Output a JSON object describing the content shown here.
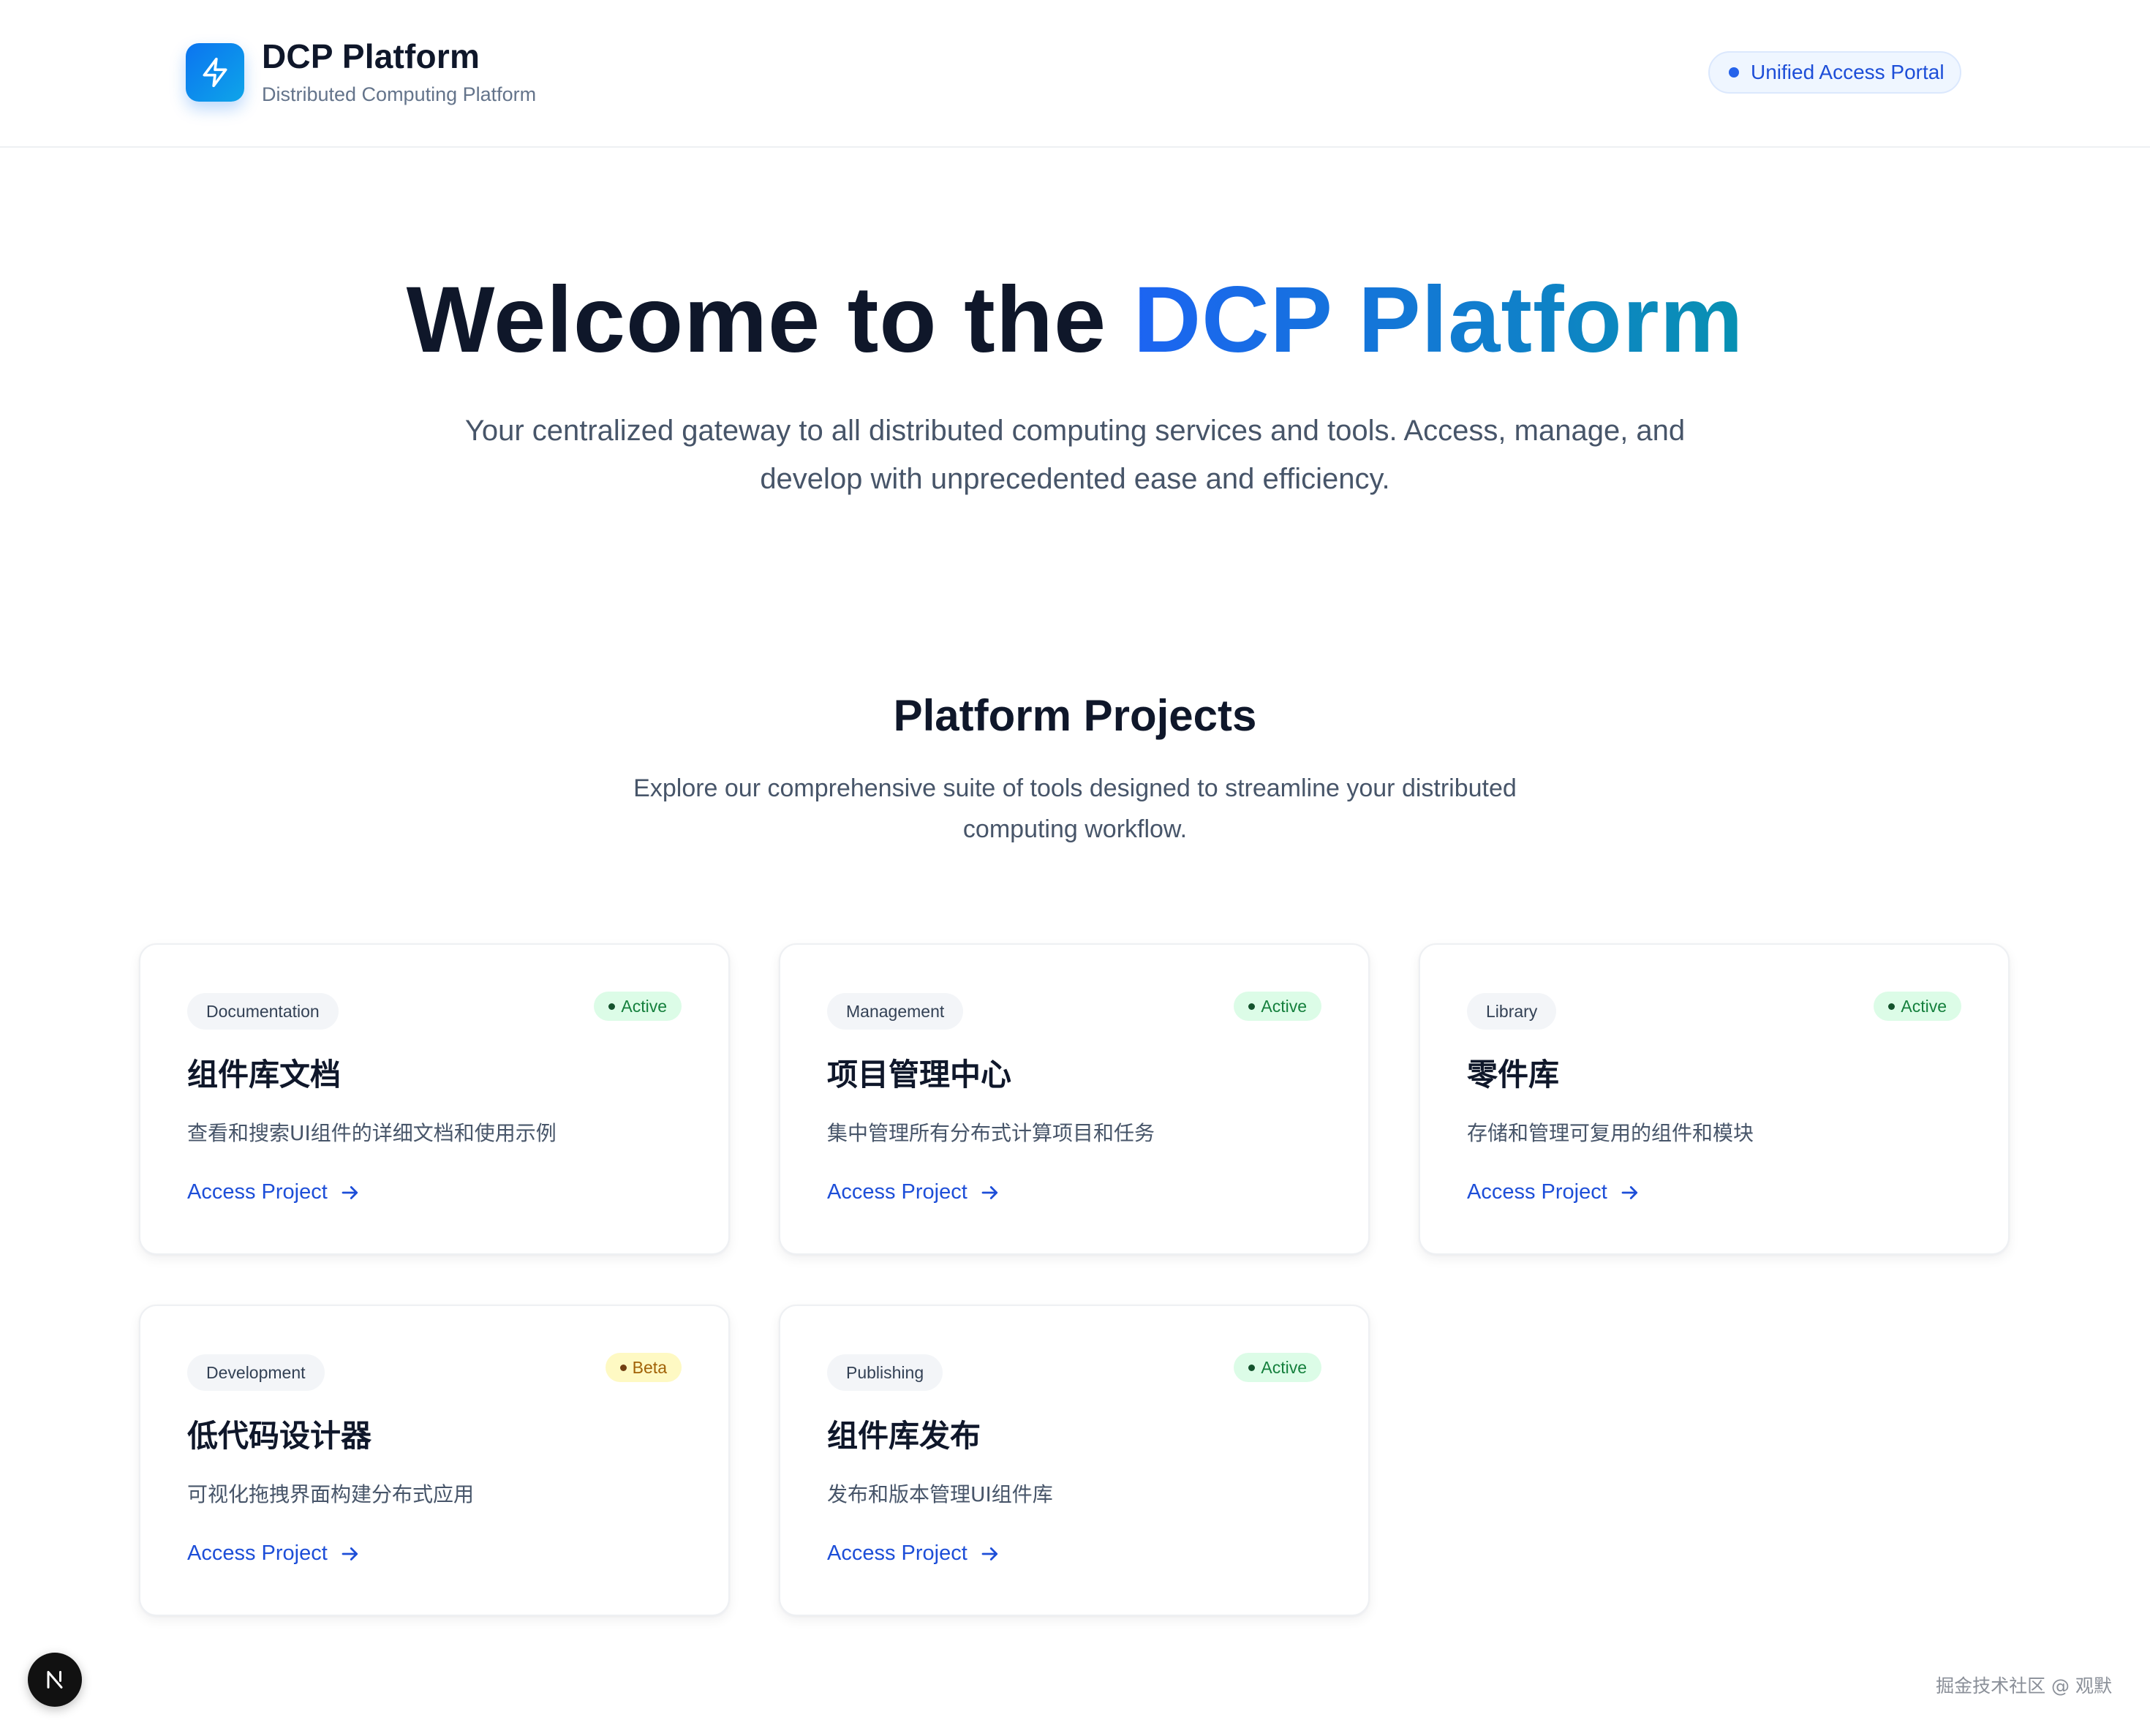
{
  "header": {
    "title": "DCP Platform",
    "subtitle": "Distributed Computing Platform",
    "logo_icon": "lightning-bolt-icon",
    "portal_badge": "Unified Access Portal",
    "accent_color": "#0b74f0"
  },
  "hero": {
    "title_prefix": "Welcome to the ",
    "title_accent": "DCP Platform",
    "subtitle": "Your centralized gateway to all distributed computing services and tools. Access, manage, and develop with unprecedented ease and efficiency."
  },
  "projects": {
    "title": "Platform Projects",
    "subtitle": "Explore our comprehensive suite of tools designed to streamline your distributed computing workflow.",
    "cards": [
      {
        "tag": "Documentation",
        "status": "Active",
        "title": "组件库文档",
        "description": "查看和搜索UI组件的详细文档和使用示例",
        "link": "Access Project"
      },
      {
        "tag": "Management",
        "status": "Active",
        "title": "项目管理中心",
        "description": "集中管理所有分布式计算项目和任务",
        "link": "Access Project"
      },
      {
        "tag": "Library",
        "status": "Active",
        "title": "零件库",
        "description": "存储和管理可复用的组件和模块",
        "link": "Access Project"
      },
      {
        "tag": "Development",
        "status": "Beta",
        "title": "低代码设计器",
        "description": "可视化拖拽界面构建分布式应用",
        "link": "Access Project"
      },
      {
        "tag": "Publishing",
        "status": "Active",
        "title": "组件库发布",
        "description": "发布和版本管理UI组件库",
        "link": "Access Project"
      }
    ]
  },
  "corner": {
    "badge_letter": "N",
    "watermark": "掘金技术社区 @ 观默"
  },
  "colors": {
    "status_active_bg": "#dcfce7",
    "status_beta_bg": "#fef9c3",
    "link": "#1d4ed8"
  }
}
